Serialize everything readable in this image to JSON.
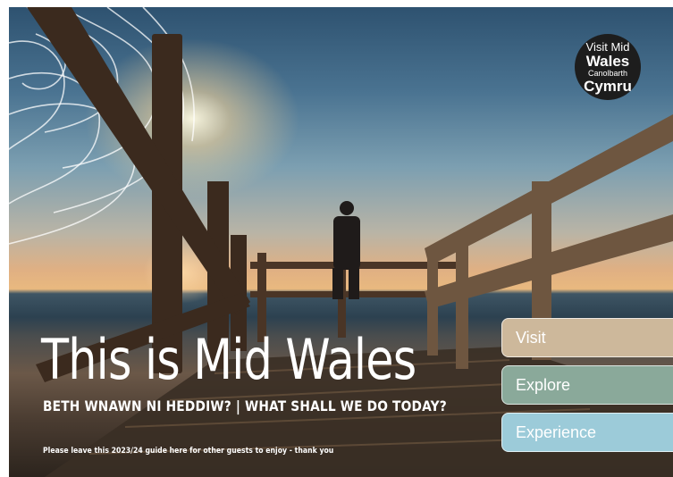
{
  "logo": {
    "line1": "Visit Mid",
    "line2": "Wales",
    "line3": "Canolbarth",
    "line4": "Cymru"
  },
  "cover": {
    "title": "This is Mid Wales",
    "subtitle": "BETH WNAWN NI HEDDIW? | WHAT SHALL WE DO TODAY?",
    "footnote": "Please leave this 2023/24 guide here for other guests to enjoy - thank you"
  },
  "nav": {
    "visit": "Visit",
    "explore": "Explore",
    "experience": "Experience"
  },
  "colors": {
    "visit": "#cdb89b",
    "explore": "#8aa99a",
    "experience": "#9ccbd9",
    "logo_bg": "#1d1d1d"
  }
}
